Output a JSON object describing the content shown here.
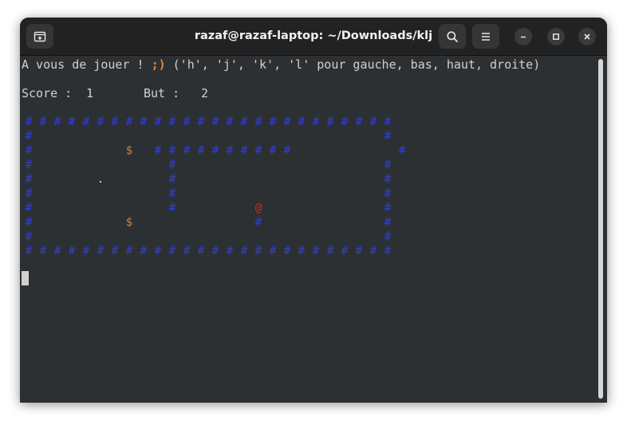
{
  "window": {
    "title": "razaf@razaf-laptop: ~/Downloads/klj"
  },
  "icons": {
    "new_tab": "new-tab-icon",
    "search": "search-icon",
    "menu": "hamburger-menu-icon",
    "minimize": "minimize-icon",
    "maximize": "maximize-icon",
    "close": "close-icon"
  },
  "terminal": {
    "prompt_text": "A vous de jouer ! ",
    "prompt_emoticon": ";)",
    "prompt_keys": " ('h', 'j', 'k', 'l' pour gauche, bas, haut, droite)",
    "score_label": "Score :",
    "score_value": "1",
    "goal_label": "But :",
    "goal_value": "2",
    "grid": [
      "##########################",
      "#                        #",
      "#      $ ##########       #",
      "#         #              #",
      "#    .    #              #",
      "#         #              #",
      "#         #     @        #",
      "#      $        #        #",
      "#                        #",
      "##########################"
    ]
  },
  "colors": {
    "background": "#2d3033",
    "text": "#d0d0d0",
    "wall": "#2f3fd8",
    "coin": "#d9822b",
    "player": "#cc2a2a",
    "dot": "#e0e0e0",
    "emoticon": "#e8862a"
  }
}
